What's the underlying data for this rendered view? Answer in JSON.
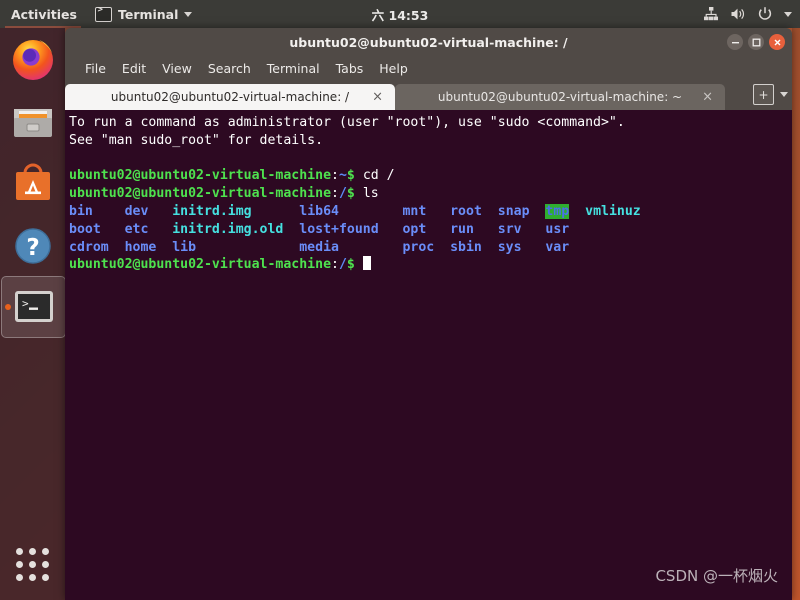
{
  "topbar": {
    "activities": "Activities",
    "app_name": "Terminal",
    "app_icon": "terminal-icon",
    "clock": "六 14:53",
    "indicators": [
      "network-icon",
      "volume-icon",
      "power-icon",
      "chevron-down-icon"
    ]
  },
  "dock": {
    "items": [
      {
        "name": "firefox",
        "label": "Firefox",
        "running": false,
        "selected": false
      },
      {
        "name": "files",
        "label": "Files",
        "running": false,
        "selected": false
      },
      {
        "name": "software",
        "label": "Ubuntu Software",
        "running": false,
        "selected": false
      },
      {
        "name": "help",
        "label": "Help",
        "running": false,
        "selected": false
      },
      {
        "name": "terminal",
        "label": "Terminal",
        "running": true,
        "selected": true
      }
    ],
    "show_apps_label": "Show Applications"
  },
  "window": {
    "title": "ubuntu02@ubuntu02-virtual-machine: /",
    "buttons": {
      "minimize": "minimize-button",
      "maximize": "maximize-button",
      "close": "close-button"
    },
    "menu": [
      "File",
      "Edit",
      "View",
      "Search",
      "Terminal",
      "Tabs",
      "Help"
    ],
    "tabs": [
      {
        "label": "ubuntu02@ubuntu02-virtual-machine: /",
        "active": true,
        "close": "×"
      },
      {
        "label": "ubuntu02@ubuntu02-virtual-machine: ~",
        "active": false,
        "close": "×"
      }
    ],
    "new_tab_label": "+",
    "tab_menu_icon": "chevron-down-icon"
  },
  "terminal": {
    "colors": {
      "background": "#2d0922",
      "foreground": "#ffffff",
      "prompt_user": "#4ee24e",
      "prompt_path": "#5d8bf7",
      "archive": "#45e0e0",
      "directory": "#6a8df8",
      "sticky_bg": "#2fae2f"
    },
    "lines": [
      {
        "type": "output",
        "segments": [
          {
            "text": "To run a command as administrator (user \"root\"), use \"sudo <command>\".",
            "style": "plain"
          }
        ]
      },
      {
        "type": "output",
        "segments": [
          {
            "text": "See \"man sudo_root\" for details.",
            "style": "plain"
          }
        ]
      },
      {
        "type": "blank",
        "segments": []
      },
      {
        "type": "prompt",
        "segments": [
          {
            "text": "ubuntu02@ubuntu02-virtual-machine",
            "style": "green"
          },
          {
            "text": ":",
            "style": "plain"
          },
          {
            "text": "~",
            "style": "blue"
          },
          {
            "text": "$ ",
            "style": "green"
          },
          {
            "text": "cd /",
            "style": "plain"
          }
        ]
      },
      {
        "type": "prompt",
        "segments": [
          {
            "text": "ubuntu02@ubuntu02-virtual-machine",
            "style": "green"
          },
          {
            "text": ":",
            "style": "plain"
          },
          {
            "text": "/",
            "style": "blue"
          },
          {
            "text": "$ ",
            "style": "green"
          },
          {
            "text": "ls",
            "style": "plain"
          }
        ]
      },
      {
        "type": "output",
        "segments": [
          {
            "text": "bin    dev   ",
            "style": "dir"
          },
          {
            "text": "initrd.img      ",
            "style": "cyan"
          },
          {
            "text": "lib64        ",
            "style": "dir"
          },
          {
            "text": "mnt   root  snap  ",
            "style": "dir"
          },
          {
            "text": "tmp",
            "style": "sticky"
          },
          {
            "text": "  ",
            "style": "plain"
          },
          {
            "text": "vmlinuz",
            "style": "cyan"
          }
        ]
      },
      {
        "type": "output",
        "segments": [
          {
            "text": "boot   etc   ",
            "style": "dir"
          },
          {
            "text": "initrd.img.old  ",
            "style": "cyan"
          },
          {
            "text": "lost+found   opt   run   srv   usr",
            "style": "dir"
          }
        ]
      },
      {
        "type": "output",
        "segments": [
          {
            "text": "cdrom  home  lib             media        proc  sbin  sys   var",
            "style": "dir"
          }
        ]
      },
      {
        "type": "prompt",
        "segments": [
          {
            "text": "ubuntu02@ubuntu02-virtual-machine",
            "style": "green"
          },
          {
            "text": ":",
            "style": "plain"
          },
          {
            "text": "/",
            "style": "blue"
          },
          {
            "text": "$ ",
            "style": "green"
          },
          {
            "text": "",
            "style": "cursor"
          }
        ]
      }
    ]
  },
  "watermark": "CSDN @一杯烟火"
}
